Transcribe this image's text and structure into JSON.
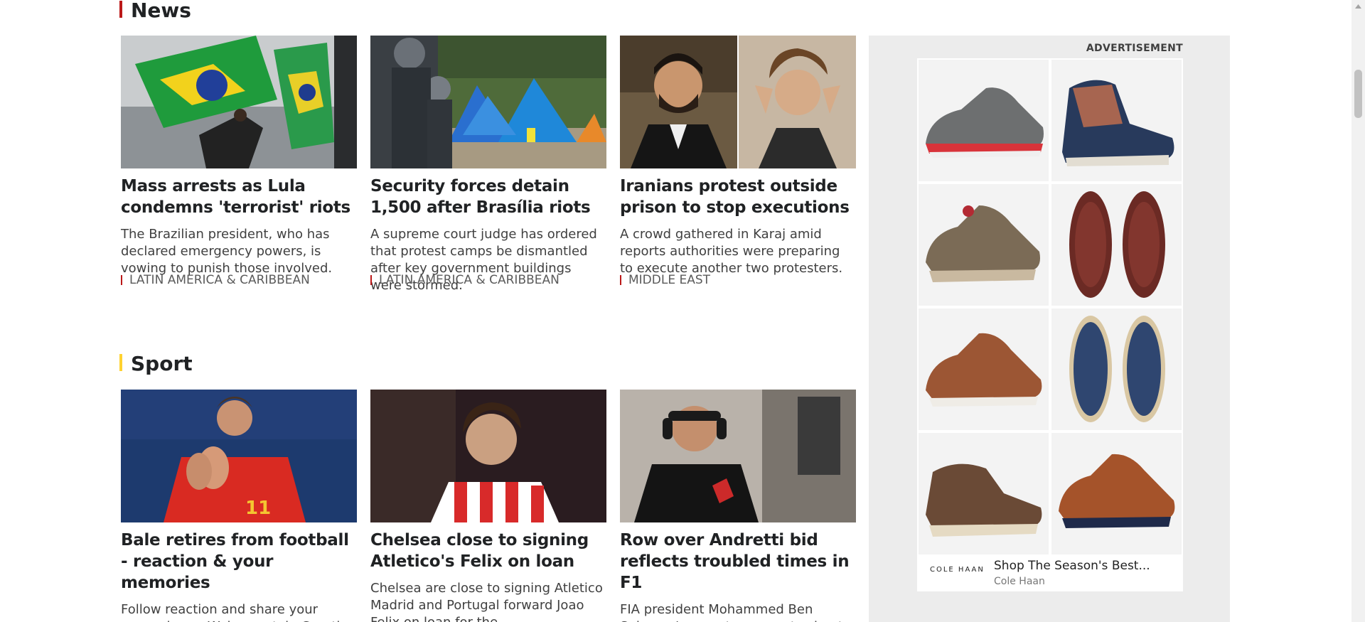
{
  "sections": {
    "news": {
      "title": "News"
    },
    "sport": {
      "title": "Sport"
    }
  },
  "news_cards": [
    {
      "headline": "Mass arrests as Lula condemns 'terrorist' riots",
      "summary": "The Brazilian president, who has declared emergency powers, is vowing to punish those involved.",
      "tag": "LATIN AMERICA & CARIBBEAN"
    },
    {
      "headline": "Security forces detain 1,500 after Brasília riots",
      "summary": "A supreme court judge has ordered that protest camps be dismantled after key government buildings were stormed.",
      "tag": "LATIN AMERICA & CARIBBEAN"
    },
    {
      "headline": "Iranians protest outside prison to stop executions",
      "summary": "A crowd gathered in Karaj amid reports authorities were preparing to execute another two protesters.",
      "tag": "MIDDLE EAST"
    }
  ],
  "sport_cards": [
    {
      "headline": "Bale retires from football - reaction & your memories",
      "summary": "Follow reaction and share your memories as Wales captain Gareth Bale announces his retirement from"
    },
    {
      "headline": "Chelsea close to signing Atletico's Felix on loan",
      "summary": "Chelsea are close to signing Atletico Madrid and Portugal forward Joao Felix on loan for the"
    },
    {
      "headline": "Row over Andretti bid reflects troubled times in F1",
      "summary": "FIA president Mohammed Ben Sulayem's recent comments about"
    }
  ],
  "advertisement": {
    "label": "ADVERTISEMENT",
    "choices_icon": "adchoices-icon",
    "headline": "Shop The Season's Best...",
    "brand": "Cole Haan",
    "logo": "COLE HAAN"
  },
  "colors": {
    "news_accent": "#bb1919",
    "sport_accent": "#ffd230",
    "ad_background": "#ececec"
  }
}
